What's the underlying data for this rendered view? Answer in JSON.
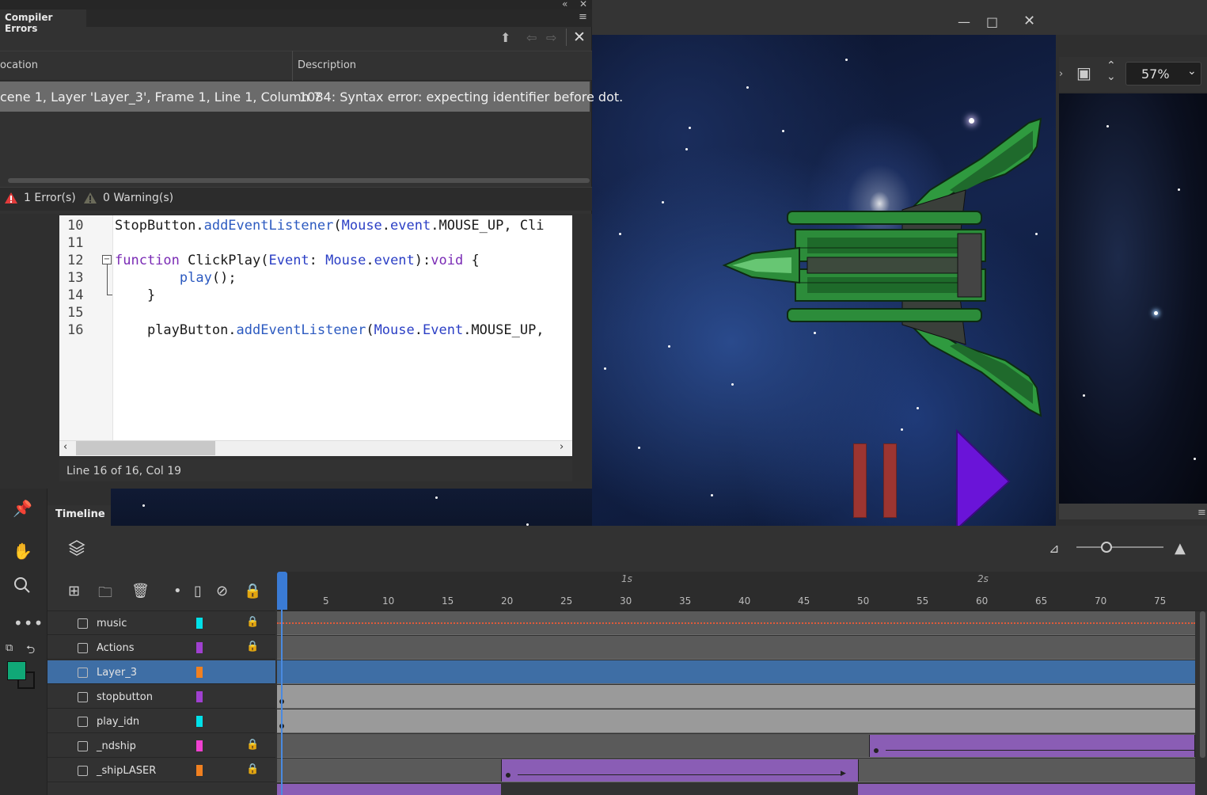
{
  "compiler_errors": {
    "title": "Compiler Errors",
    "column_location": "ocation",
    "column_description": "Description",
    "row_location": "cene 1, Layer 'Layer_3', Frame 1, Line 1, Column 7",
    "row_description": "1084: Syntax error: expecting identifier before dot.",
    "errors": "1 Error(s)",
    "warnings": "0 Warning(s)"
  },
  "editor": {
    "line_numbers": [
      "10",
      "11",
      "12",
      "13",
      "14",
      "15",
      "16"
    ],
    "line10": {
      "obj": "StopButton.",
      "method": "addEventListener",
      "paren": "(",
      "cls": "Mouse",
      "dot": ".",
      "evt": "event",
      "rest": ".MOUSE_UP, ",
      "tail": "Cli"
    },
    "line12": {
      "kw": "function",
      "name": " ClickPlay(",
      "param": "Event",
      "colon": ": ",
      "cls": "Mouse",
      "dot": ".",
      "evt": "event",
      "close": "):",
      "ret": "void",
      "brace": " {"
    },
    "line13": {
      "indent": "        ",
      "fn": "play",
      "rest": "();"
    },
    "line14": {
      "text": "    }"
    },
    "line16": {
      "indent": "    ",
      "obj": "playButton.",
      "method": "addEventListener",
      "paren": "(",
      "cls": "Mouse",
      "dot": ".",
      "evt": "Event",
      "rest": ".MOUSE_UP,"
    },
    "status": "Line 16 of 16, Col 19"
  },
  "stage": {
    "zoom": "57%"
  },
  "timeline": {
    "tab": "Timeline",
    "seconds": [
      "1s",
      "2s"
    ],
    "frame_ticks": [
      "5",
      "10",
      "15",
      "20",
      "25",
      "30",
      "35",
      "40",
      "45",
      "50",
      "55",
      "60",
      "65",
      "70",
      "75"
    ],
    "layers": [
      {
        "name": "music",
        "color": "#00e0e8",
        "locked": true
      },
      {
        "name": "Actions",
        "color": "#a040d0",
        "locked": true
      },
      {
        "name": "Layer_3",
        "color": "#f08020",
        "locked": false
      },
      {
        "name": "stopbutton",
        "color": "#a040d0",
        "locked": false
      },
      {
        "name": "play_idn",
        "color": "#00e0e8",
        "locked": false
      },
      {
        "name": "_ndship",
        "color": "#f040d0",
        "locked": true
      },
      {
        "name": "_shipLASER",
        "color": "#f08020",
        "locked": true
      }
    ]
  },
  "icons": {
    "pin": "pin-icon",
    "hand": "hand-icon",
    "zoom": "zoom-icon",
    "more": "more-icon",
    "layers": "layers-icon"
  }
}
